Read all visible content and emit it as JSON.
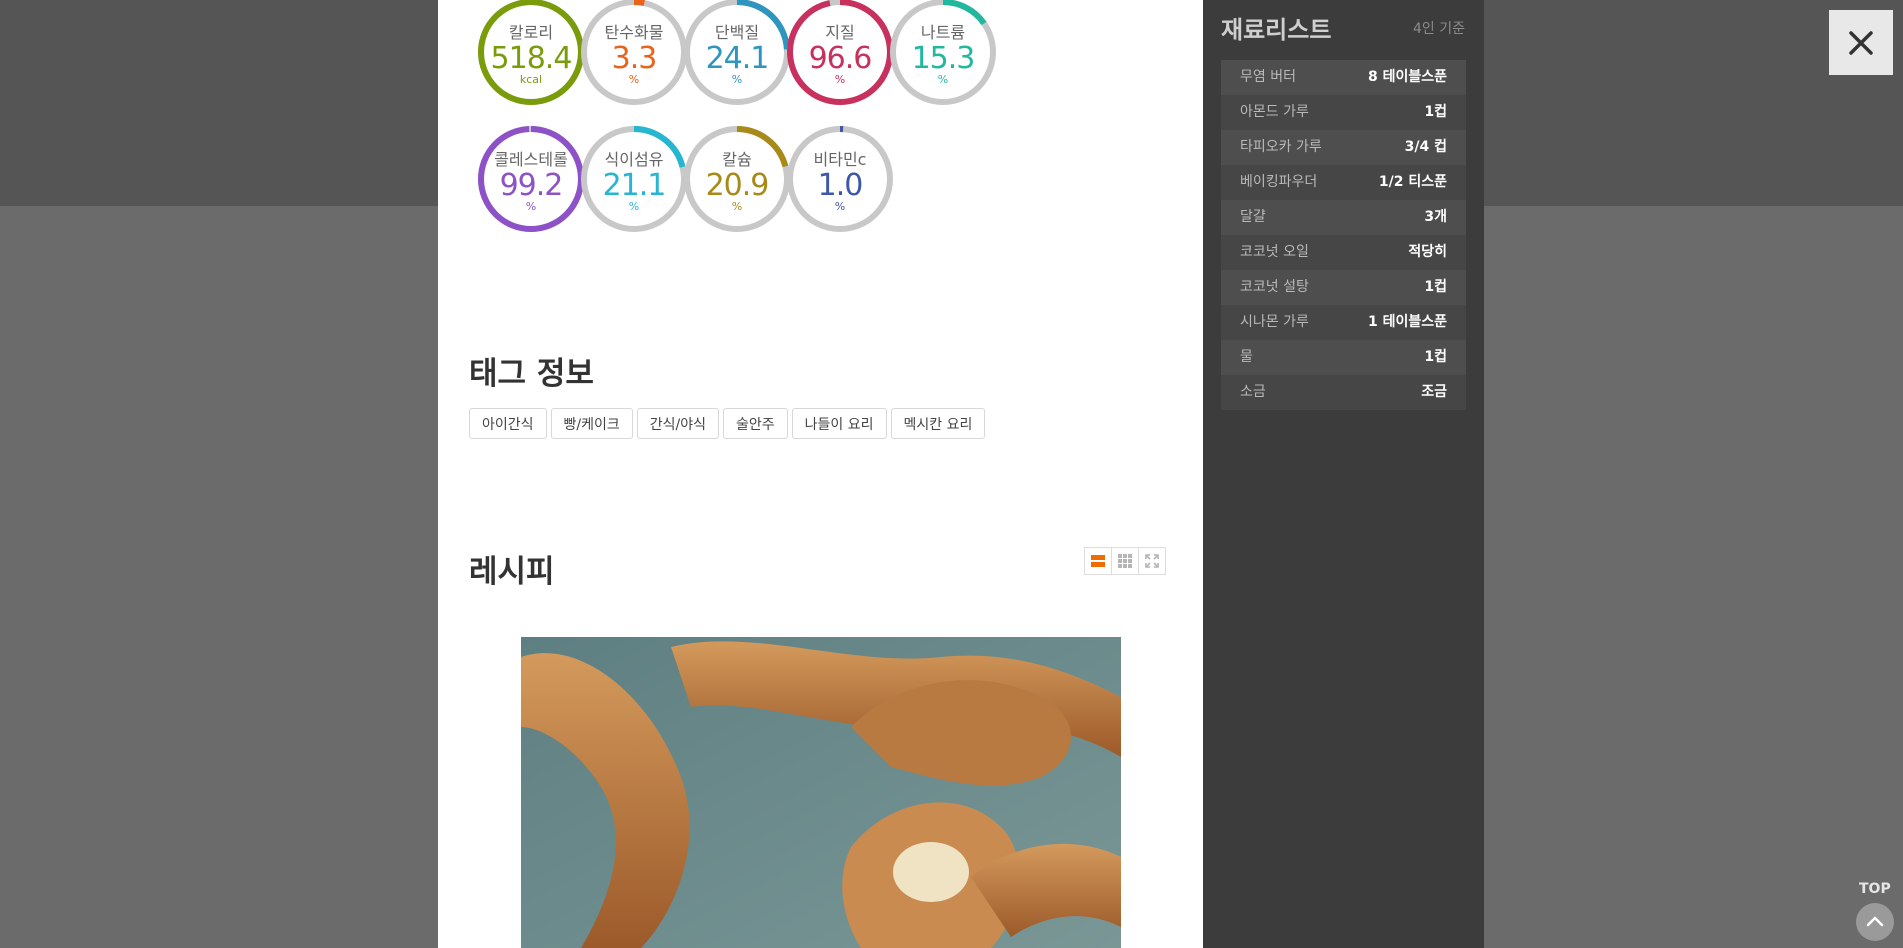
{
  "nutrition": [
    {
      "label": "칼로리",
      "value": "518.4",
      "unit": "kcal",
      "color": "#7a9c0b",
      "fraction": 1.0
    },
    {
      "label": "탄수화물",
      "value": "3.3",
      "unit": "%",
      "color": "#e8641b",
      "fraction": 0.033
    },
    {
      "label": "단백질",
      "value": "24.1",
      "unit": "%",
      "color": "#2d95c0",
      "fraction": 0.241
    },
    {
      "label": "지질",
      "value": "96.6",
      "unit": "%",
      "color": "#c8305e",
      "fraction": 0.966
    },
    {
      "label": "나트륨",
      "value": "15.3",
      "unit": "%",
      "color": "#22b8a0",
      "fraction": 0.153
    },
    {
      "label": "콜레스테롤",
      "value": "99.2",
      "unit": "%",
      "color": "#8d52c8",
      "fraction": 0.992
    },
    {
      "label": "식이섬유",
      "value": "21.1",
      "unit": "%",
      "color": "#27b6d0",
      "fraction": 0.211
    },
    {
      "label": "칼슘",
      "value": "20.9",
      "unit": "%",
      "color": "#a88a18",
      "fraction": 0.209
    },
    {
      "label": "비타민c",
      "value": "1.0",
      "unit": "%",
      "color": "#3f57a8",
      "fraction": 0.01
    }
  ],
  "tags_section": {
    "title": "태그 정보",
    "tags": [
      "아이간식",
      "빵/케이크",
      "간식/야식",
      "술안주",
      "나들이 요리",
      "멕시칸 요리"
    ]
  },
  "recipe_section": {
    "title": "레시피"
  },
  "ingredients": {
    "title": "재료리스트",
    "servings": "4인 기준",
    "items": [
      {
        "name": "무염 버터",
        "amount": "8 테이블스푼"
      },
      {
        "name": "아몬드 가루",
        "amount": "1컵"
      },
      {
        "name": "타피오카 가루",
        "amount": "3/4 컵"
      },
      {
        "name": "베이킹파우더",
        "amount": "1/2 티스푼"
      },
      {
        "name": "달걀",
        "amount": "3개"
      },
      {
        "name": "코코넛 오일",
        "amount": "적당히"
      },
      {
        "name": "코코넛 설탕",
        "amount": "1컵"
      },
      {
        "name": "시나몬 가루",
        "amount": "1 테이블스푼"
      },
      {
        "name": "물",
        "amount": "1컵"
      },
      {
        "name": "소금",
        "amount": "조금"
      }
    ]
  },
  "top_button": {
    "label": "TOP"
  },
  "icons": {
    "close": "close-icon",
    "top": "chevron-up-icon"
  }
}
